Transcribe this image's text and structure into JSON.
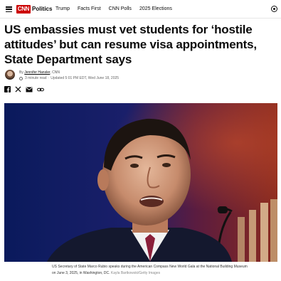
{
  "nav": {
    "logo_text": "CNN",
    "section_name": "Politics",
    "links": [
      "Trump",
      "Facts First",
      "CNN Polls",
      "2025 Elections"
    ],
    "brand_color": "#cc0000"
  },
  "article": {
    "headline": "US embassies must vet students for ‘hostile attitudes’ but can resume visa appointments, State Department says",
    "byline_prefix": "By",
    "author": "Jennifer Hansler",
    "outlet": ", CNN",
    "read_time": "3 minute read",
    "updated": "Updated 5:01 PM EDT, Wed June 18, 2025",
    "share_icons": [
      "facebook-icon",
      "x-icon",
      "email-icon",
      "link-icon"
    ]
  },
  "image": {
    "caption": "US Secretary of State Marco Rubio speaks during the American Compass New World Gala at the National Building Museum on June 3, 2025, in Washington, DC.",
    "credit": "Kayla Bartkowski/Getty Images"
  }
}
